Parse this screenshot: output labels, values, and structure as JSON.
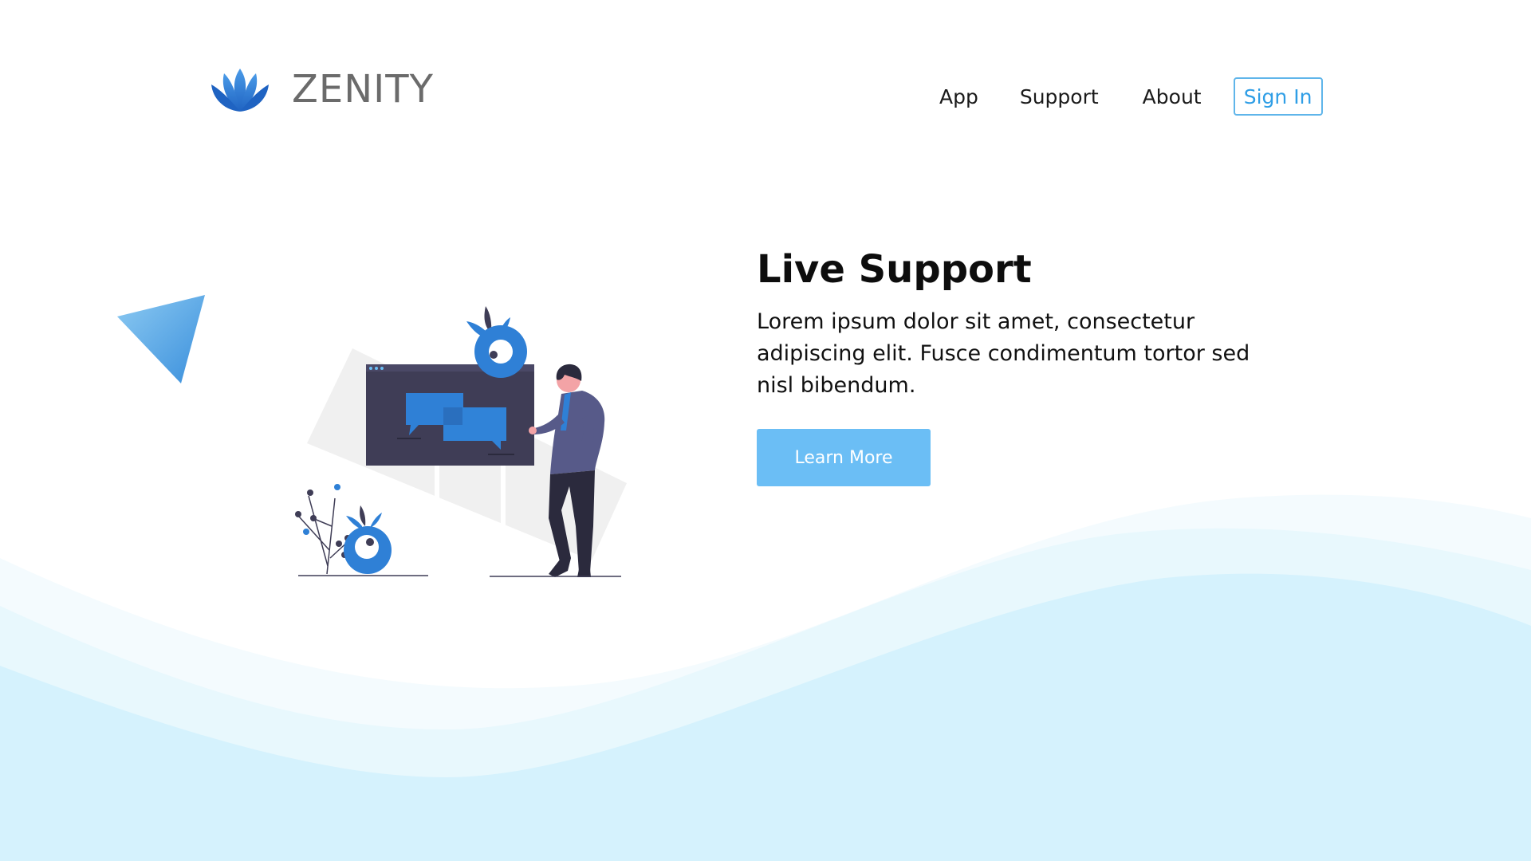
{
  "brand": {
    "name": "ZENITY",
    "logo_icon": "lotus-icon",
    "logo_color": "#2f7fd6"
  },
  "nav": {
    "items": [
      {
        "label": "App"
      },
      {
        "label": "Support"
      },
      {
        "label": "About"
      }
    ],
    "signin_label": "Sign In"
  },
  "hero": {
    "title": "Live Support",
    "text": "Lorem ipsum dolor sit amet, consectetur adipiscing elit. Fusce condimentum tortor sed nisl bibendum.",
    "button_label": "Learn More"
  },
  "colors": {
    "accent": "#6bbef5",
    "signin_border": "#5fb5ea",
    "wave_light": "#eaf8fd",
    "wave_main": "#d5f2fd",
    "illustration_blue": "#2f80d6",
    "illustration_dark": "#3f3d56"
  }
}
